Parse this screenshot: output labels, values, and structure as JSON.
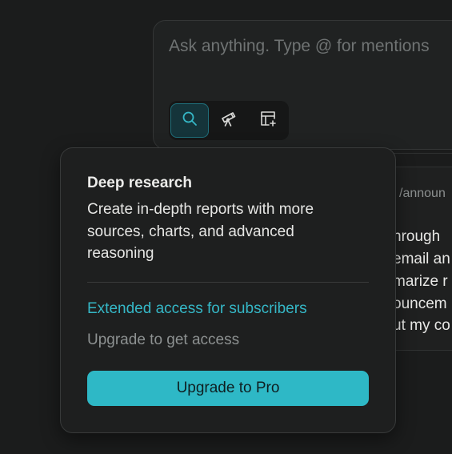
{
  "composer": {
    "placeholder": "Ask anything. Type @ for mentions",
    "modes": [
      {
        "name": "search",
        "icon": "search-icon",
        "active": true
      },
      {
        "name": "research",
        "icon": "telescope-icon",
        "active": false
      },
      {
        "name": "labs",
        "icon": "grid-plus-icon",
        "active": false
      }
    ]
  },
  "background_card": {
    "path": "/announ",
    "lines": [
      "hrough",
      "email an",
      "marize r",
      "ouncem",
      "ut my co"
    ]
  },
  "popover": {
    "title": "Deep research",
    "description": "Create in-depth reports with more sources, charts, and advanced reasoning",
    "access_label": "Extended access for subscribers",
    "upgrade_note": "Upgrade to get access",
    "button_label": "Upgrade to Pro"
  },
  "colors": {
    "background": "#1b1c1c",
    "accent": "#2eb8c6",
    "accent_text": "#35b7c6",
    "active_mode_bg": "#15343a"
  }
}
